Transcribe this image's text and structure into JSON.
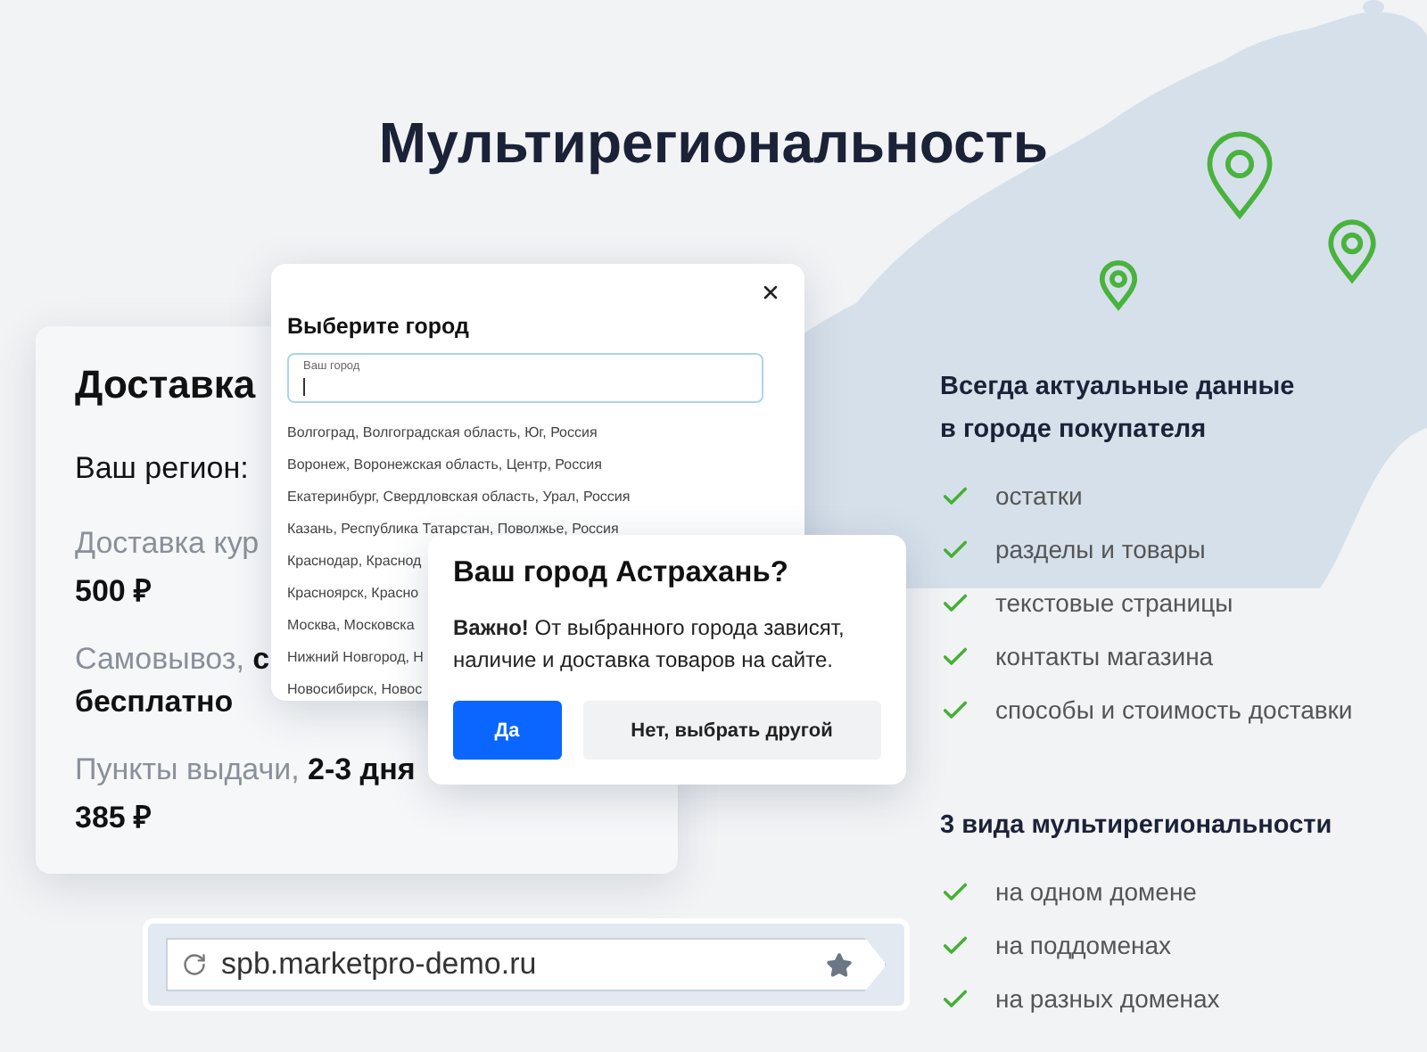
{
  "title": "Мультирегиональность",
  "delivery": {
    "heading": "Доставка",
    "region_label": "Ваш регион:",
    "rows": [
      {
        "line": "Доставка кур",
        "price": "500 ₽"
      },
      {
        "line": "Самовывоз, **с**",
        "price": "бесплатно"
      },
      {
        "line": "Пункты выдачи, **2-3 дня**",
        "price": "385 ₽"
      }
    ]
  },
  "city_picker": {
    "title": "Выберите город",
    "field_label": "Ваш город",
    "cities": [
      "Волгоград, Волгоградская область, Юг, Россия",
      "Воронеж, Воронежская область, Центр, Россия",
      "Екатеринбург, Свердловская область, Урал, Россия",
      "Казань, Республика Татарстан, Поволжье, Россия",
      "Краснодар, Краснод",
      "Красноярск, Красно",
      "Москва, Московска",
      "Нижний Новгород, Н",
      "Новосибирск, Новос"
    ]
  },
  "confirm": {
    "title": "Ваш город Астрахань?",
    "message": "**Важно!** От выбранного города зависят, наличие и доставка товаров на сайте.",
    "buttons": [
      {
        "label": "Да",
        "kind": "primary"
      },
      {
        "label": "Нет, выбрать другой",
        "kind": "secondary"
      }
    ]
  },
  "url_bar": {
    "url": "spb.marketpro-demo.ru"
  },
  "features": [
    {
      "heading": "Всегда актуальные данные в городе покупателя",
      "items": [
        "остатки",
        "разделы и товары",
        "текстовые страницы",
        "контакты магазина",
        "способы и стоимость доставки"
      ]
    },
    {
      "heading": "3 вида мультирегиональности",
      "items": [
        "на одном домене",
        "на поддоменах",
        "на разных доменах"
      ]
    }
  ]
}
